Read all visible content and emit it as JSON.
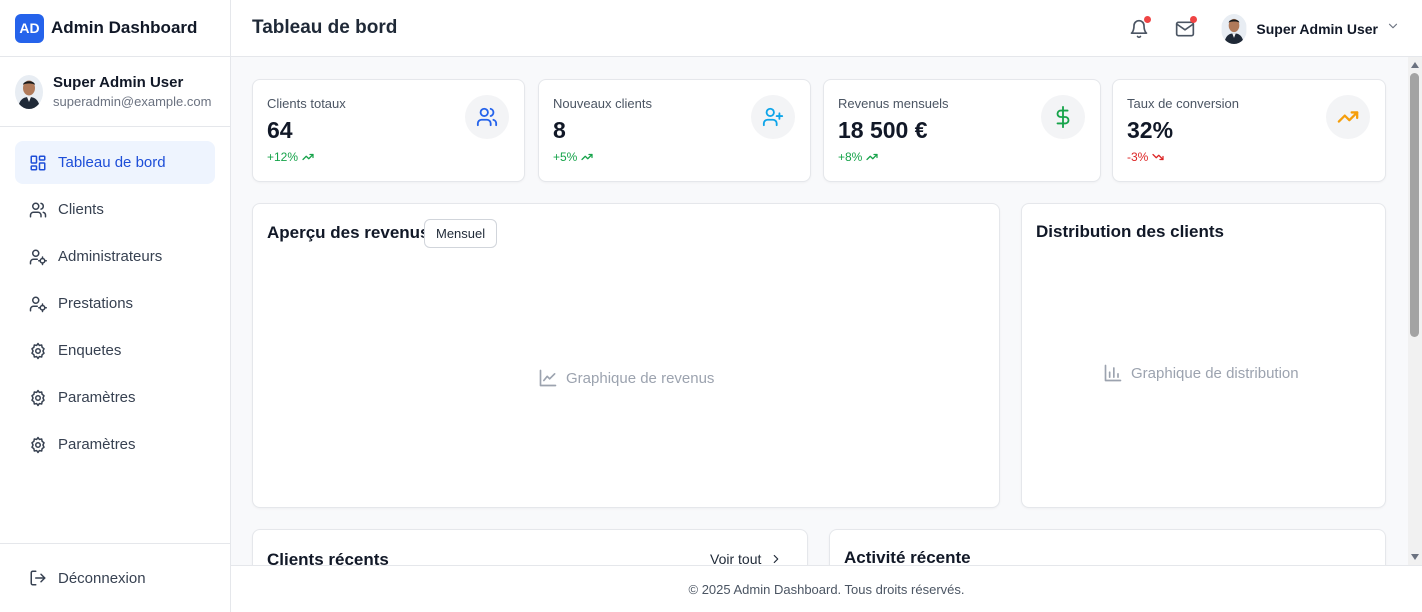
{
  "brand": {
    "logo_text": "AD",
    "name": "Admin Dashboard",
    "logo_color": "#2563eb"
  },
  "profile": {
    "name": "Super Admin User",
    "email": "superadmin@example.com"
  },
  "nav": {
    "items": [
      {
        "label": "Tableau de bord",
        "icon": "dashboard-icon",
        "active": true
      },
      {
        "label": "Clients",
        "icon": "users-icon"
      },
      {
        "label": "Administrateurs",
        "icon": "user-cog-icon"
      },
      {
        "label": "Prestations",
        "icon": "user-cog-icon"
      },
      {
        "label": "Enquetes",
        "icon": "gear-icon"
      },
      {
        "label": "Paramètres",
        "icon": "gear-icon"
      },
      {
        "label": "Paramètres",
        "icon": "gear-icon"
      }
    ],
    "logout_label": "Déconnexion"
  },
  "header": {
    "title": "Tableau de bord",
    "user_name": "Super Admin User",
    "notifications_icon": "bell-icon",
    "messages_icon": "mail-icon"
  },
  "stats": [
    {
      "label": "Clients totaux",
      "value": "64",
      "trend": "+12%",
      "direction": "up",
      "icon": "users-icon",
      "icon_color": "#2563eb"
    },
    {
      "label": "Nouveaux clients",
      "value": "8",
      "trend": "+5%",
      "direction": "up",
      "icon": "user-plus-icon",
      "icon_color": "#0ea5e9"
    },
    {
      "label": "Revenus mensuels",
      "value": "18 500 €",
      "trend": "+8%",
      "direction": "up",
      "icon": "dollar-icon",
      "icon_color": "#16a34a"
    },
    {
      "label": "Taux de conversion",
      "value": "32%",
      "trend": "-3%",
      "direction": "down",
      "icon": "trending-up-icon",
      "icon_color": "#f59e0b"
    }
  ],
  "revenue_card": {
    "title": "Aperçu des revenus",
    "period_button": "Mensuel",
    "placeholder": "Graphique de revenus"
  },
  "distribution_card": {
    "title": "Distribution des clients",
    "placeholder": "Graphique de distribution"
  },
  "recent_clients": {
    "title": "Clients récents",
    "view_all": "Voir tout"
  },
  "recent_activity": {
    "title": "Activité récente"
  },
  "footer": {
    "text": "© 2025 Admin Dashboard. Tous droits réservés."
  },
  "colors": {
    "accent": "#2563eb",
    "active_bg": "#eef4fe",
    "positive": "#16a34a",
    "negative": "#dc2626",
    "badge": "#ef4444"
  }
}
